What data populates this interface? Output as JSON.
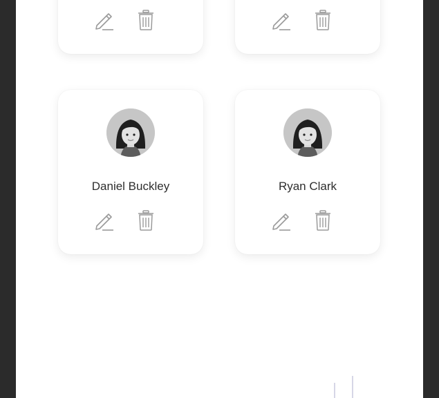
{
  "contacts_top_row": [
    {
      "edit_icon": "pencil-icon",
      "delete_icon": "trash-icon"
    },
    {
      "edit_icon": "pencil-icon",
      "delete_icon": "trash-icon"
    }
  ],
  "contacts": [
    {
      "name": "Daniel Buckley",
      "avatar_icon": "user-avatar-icon",
      "edit_icon": "pencil-icon",
      "delete_icon": "trash-icon"
    },
    {
      "name": "Ryan Clark",
      "avatar_icon": "user-avatar-icon",
      "edit_icon": "pencil-icon",
      "delete_icon": "trash-icon"
    }
  ],
  "colors": {
    "screen_background": "#ffffff",
    "frame_background": "#2b2b2b",
    "icon_gray": "#9a9a9a",
    "text": "#2e2e2e"
  }
}
